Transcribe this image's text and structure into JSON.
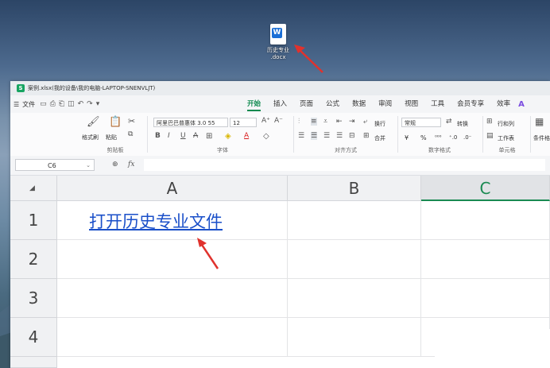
{
  "desktop": {
    "file_icon": {
      "glyph": "W",
      "label_line1": "历史专业",
      "label_line2": ".docx",
      "icon": "word-doc-icon"
    }
  },
  "window": {
    "app_logo": "S",
    "title": "案例.xlsx(我的设备\\我的电脑-LAPTOP-SNENVLJT)"
  },
  "menubar": {
    "menu_icon": "☰",
    "file_label": "文件",
    "tabs": [
      "开始",
      "插入",
      "页面",
      "公式",
      "数据",
      "审阅",
      "视图",
      "工具",
      "会员专享",
      "效率"
    ],
    "active_tab": "开始",
    "ai_logo": "A"
  },
  "ribbon": {
    "format_painter": "格式刷",
    "paste": "粘贴",
    "clipboard_group": "剪贴板",
    "font_name": "阿里巴巴普惠体 3.0 55",
    "font_size": "12",
    "font_group": "字体",
    "wrap": "换行",
    "merge": "合并",
    "align_group": "对齐方式",
    "number_format": "常规",
    "convert": "转换",
    "number_group": "数字格式",
    "rows_cols": "行和列",
    "worksheet": "工作表",
    "cells_group": "单元格",
    "cond_format": "条件格式",
    "bold": "B",
    "italic": "I",
    "underline": "U",
    "strike": "A",
    "percent": "%",
    "yen": "¥"
  },
  "formula_bar": {
    "name_box": "C6",
    "fx": "fx",
    "zoom_icon": "⊕"
  },
  "sheet": {
    "columns": [
      "A",
      "B",
      "C"
    ],
    "selected_column": "C",
    "rows": [
      "1",
      "2",
      "3",
      "4"
    ],
    "a1_value": "打开历史专业文件"
  },
  "colors": {
    "accent": "#0f8a4f",
    "link": "#1a4fc9",
    "arrow": "#e0322d"
  }
}
